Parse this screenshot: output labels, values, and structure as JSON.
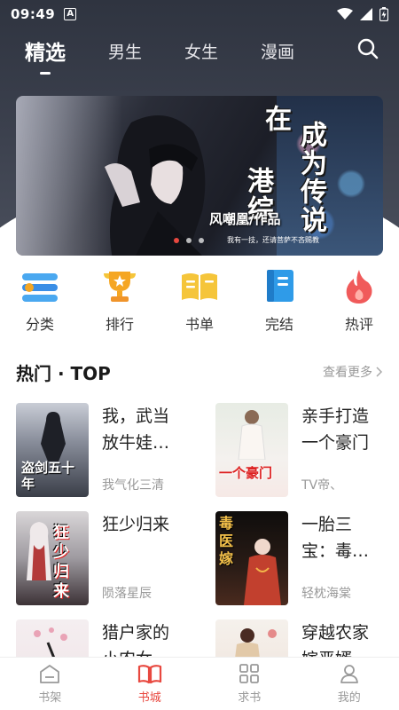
{
  "status_bar": {
    "time": "09:49",
    "badge": "A"
  },
  "top_nav": {
    "tabs": [
      {
        "label": "精选",
        "active": true
      },
      {
        "label": "男生",
        "active": false
      },
      {
        "label": "女生",
        "active": false
      },
      {
        "label": "漫画",
        "active": false
      }
    ],
    "search_icon": "search-icon"
  },
  "banner": {
    "title_lines": [
      "在",
      "港综",
      "成为传说"
    ],
    "author": "风嘲凰/作品",
    "caption": "我有一技，还请菩萨不吝赐教",
    "dots": 3,
    "active_dot": 0
  },
  "categories": [
    {
      "label": "分类",
      "icon": "category-icon",
      "color": "#3a8ee6"
    },
    {
      "label": "排行",
      "icon": "trophy-icon",
      "color": "#f5a623"
    },
    {
      "label": "书单",
      "icon": "book-open-icon",
      "color": "#f5c53a"
    },
    {
      "label": "完结",
      "icon": "notebook-icon",
      "color": "#2f9be8"
    },
    {
      "label": "热评",
      "icon": "flame-icon",
      "color": "#f05a5a"
    }
  ],
  "section": {
    "title": "热门 · TOP",
    "more": "查看更多",
    "more_icon": "chevron-right-icon"
  },
  "books": [
    {
      "title": "我，武当放牛娃…",
      "author": "我气化三清",
      "cover_text": "盗剑五十年"
    },
    {
      "title": "亲手打造一个豪门",
      "author": "TV帝、",
      "cover_text": "一个豪门"
    },
    {
      "title": "狂少归来",
      "author": "陨落星辰",
      "cover_text": "狂少归来"
    },
    {
      "title": "一胎三宝：毒…",
      "author": "轻枕海棠",
      "cover_text": "毒医嫁"
    },
    {
      "title": "猎户家的小农女",
      "author": "",
      "cover_text": ""
    },
    {
      "title": "穿越农家嫁恶婿",
      "author": "",
      "cover_text": ""
    }
  ],
  "tabbar": [
    {
      "label": "书架",
      "icon": "bookshelf-icon",
      "active": false
    },
    {
      "label": "书城",
      "icon": "bookstore-icon",
      "active": true
    },
    {
      "label": "求书",
      "icon": "grid-icon",
      "active": false
    },
    {
      "label": "我的",
      "icon": "user-icon",
      "active": false
    }
  ],
  "colors": {
    "accent": "#e8483f",
    "header": "#2f3440"
  }
}
